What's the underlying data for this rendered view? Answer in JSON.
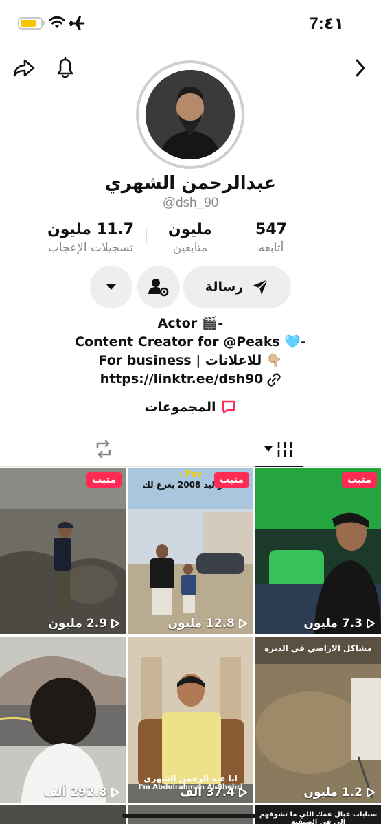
{
  "status_bar": {
    "time": "7:٤١",
    "battery_color": "#f7c600"
  },
  "nav": {
    "back_icon": "chevron-right-icon",
    "bell_icon": "bell-icon",
    "share_icon": "share-icon"
  },
  "profile": {
    "display_name": "عبدالرحمن الشهري",
    "handle": "@dsh_90"
  },
  "stats": [
    {
      "value": "547",
      "label": "أتابعه"
    },
    {
      "value": "مليون",
      "label": "متابعين"
    },
    {
      "value": "11.7 مليون",
      "label": "تسجيلات الإعجاب"
    }
  ],
  "actions": {
    "message_label": "رسالة"
  },
  "bio": {
    "line1": "Actor 🎬-",
    "line2": "Content Creator for @Peaks 🩵-",
    "line3": "For business | للاعلانات 👇🏼",
    "link": "https://linktr.ee/dsh90"
  },
  "groups_label": "المجموعات",
  "accent": "#fe2c55",
  "pinned_label": "مثبت",
  "videos": [
    {
      "views": "7.3 مليون",
      "pinned": true
    },
    {
      "views": "12.8 مليون",
      "pinned": true,
      "caption_top": "Pov :",
      "caption": "ك مواليد 2008 يغزع لك"
    },
    {
      "views": "2.9 مليون",
      "pinned": true
    },
    {
      "views": "1.2 مليون",
      "pinned": false,
      "caption": "مشاكل الاراضي في الديره"
    },
    {
      "views": "37.4 ألف",
      "pinned": false,
      "caption": "انا عبد الرحمن الشهري",
      "caption_en": "I'm Abdulrahman Al-Shehri"
    },
    {
      "views": "292.8 ألف",
      "pinned": false
    }
  ],
  "bottom_caption": "سنابات عيال عمك اللي ما تشوفهم الى في الصيفيه"
}
